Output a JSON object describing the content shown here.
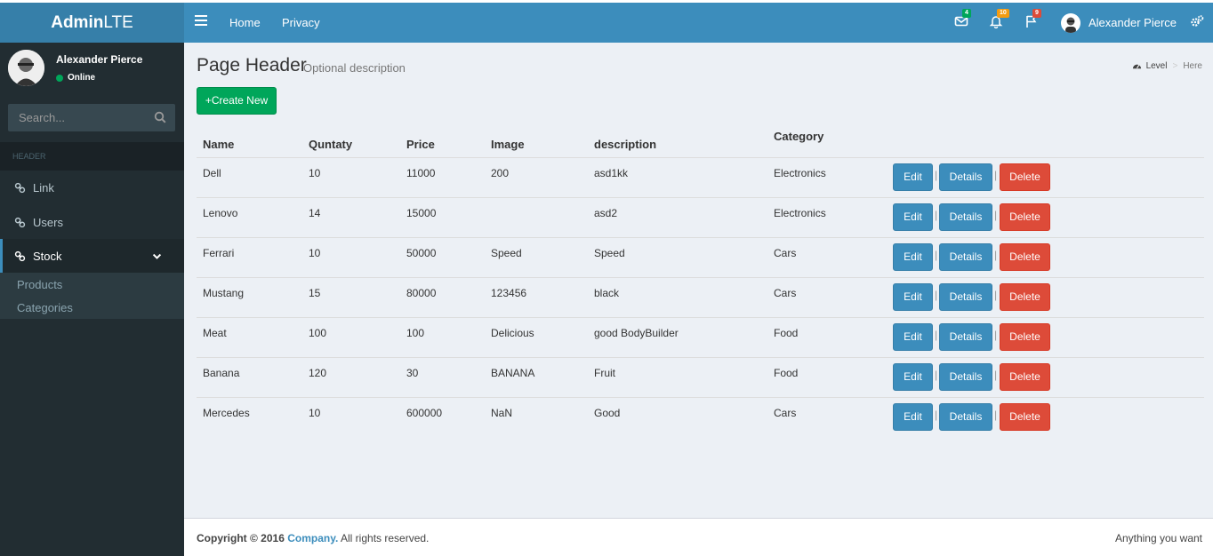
{
  "logo": {
    "bold": "Admin",
    "light": "LTE"
  },
  "navbar": {
    "links": [
      "Home",
      "Privacy"
    ],
    "messages_count": "4",
    "notifications_count": "10",
    "flags_count": "9",
    "user_name": "Alexander Pierce",
    "colors": {
      "messages_badge": "#00a65a",
      "notifications_badge": "#f39c12",
      "flags_badge": "#dd4b39"
    }
  },
  "sidebar": {
    "user_name": "Alexander Pierce",
    "status": "Online",
    "search_placeholder": "Search...",
    "header": "HEADER",
    "items": [
      {
        "label": "Link",
        "icon": "link-icon"
      },
      {
        "label": "Users",
        "icon": "link-icon"
      },
      {
        "label": "Stock",
        "icon": "link-icon"
      }
    ],
    "submenu": [
      "Products",
      "Categories"
    ]
  },
  "content": {
    "title": "Page Header",
    "description": "Optional description",
    "breadcrumb": {
      "level": "Level",
      "current": "Here"
    },
    "create_button": "+Create New",
    "columns": [
      "Name",
      "Quntaty",
      "Price",
      "Image",
      "description",
      "Category"
    ],
    "rows": [
      {
        "name": "Dell",
        "qty": "10",
        "price": "11000",
        "image": "200",
        "description": "asd1kk",
        "category": "Electronics"
      },
      {
        "name": "Lenovo",
        "qty": "14",
        "price": "15000",
        "image": "",
        "description": "asd2",
        "category": "Electronics"
      },
      {
        "name": "Ferrari",
        "qty": "10",
        "price": "50000",
        "image": "Speed",
        "description": "Speed",
        "category": "Cars"
      },
      {
        "name": "Mustang",
        "qty": "15",
        "price": "80000",
        "image": "123456",
        "description": "black",
        "category": "Cars"
      },
      {
        "name": "Meat",
        "qty": "100",
        "price": "100",
        "image": "Delicious",
        "description": "good BodyBuilder",
        "category": "Food"
      },
      {
        "name": "Banana",
        "qty": "120",
        "price": "30",
        "image": "BANANA",
        "description": "Fruit",
        "category": "Food"
      },
      {
        "name": "Mercedes",
        "qty": "10",
        "price": "600000",
        "image": "NaN",
        "description": "Good",
        "category": "Cars"
      }
    ],
    "actions": {
      "edit": "Edit",
      "details": "Details",
      "delete": "Delete",
      "separator": "|"
    }
  },
  "footer": {
    "copyright": "Copyright © 2016",
    "company": "Company.",
    "rights": "All rights reserved.",
    "right_text": "Anything you want"
  }
}
